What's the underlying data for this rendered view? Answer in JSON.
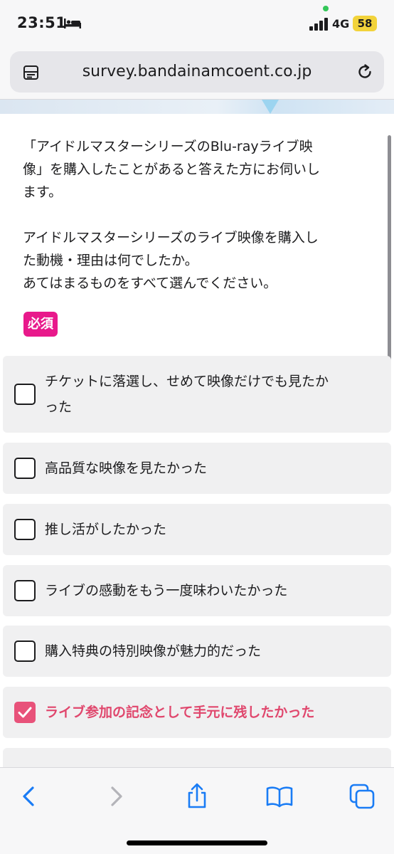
{
  "status": {
    "time": "23:51",
    "network": "4G",
    "battery": "58"
  },
  "browser": {
    "url": "survey.bandainamcoent.co.jp"
  },
  "question": {
    "line1": "「アイドルマスターシリーズのBlu-rayライブ映",
    "line2": "像」を購入したことがあると答えた方にお伺いし",
    "line3": "ます。",
    "line4": "アイドルマスターシリーズのライブ映像を購入し",
    "line5": "た動機・理由は何でしたか。",
    "line6": "あてはまるものをすべて選んでください。",
    "required_label": "必須"
  },
  "options": [
    {
      "line1": "チケットに落選し、せめて映像だけでも見たか",
      "line2": "った",
      "checked": false
    },
    {
      "line1": "高品質な映像を見たかった",
      "checked": false
    },
    {
      "line1": "推し活がしたかった",
      "checked": false
    },
    {
      "line1": "ライブの感動をもう一度味わいたかった",
      "checked": false
    },
    {
      "line1": "購入特典の特別映像が魅力的だった",
      "checked": false
    },
    {
      "line1": "ライブ参加の記念として手元に残したかった",
      "checked": true
    }
  ],
  "colors": {
    "accent_pink": "#e8198b",
    "selected_text": "#e0476d",
    "checkbox_checked": "#e8527a",
    "toolbar_blue": "#1a7cf5"
  },
  "toolbar": {
    "icons": [
      "back-icon",
      "forward-icon",
      "share-icon",
      "bookmarks-icon",
      "tabs-icon"
    ]
  }
}
